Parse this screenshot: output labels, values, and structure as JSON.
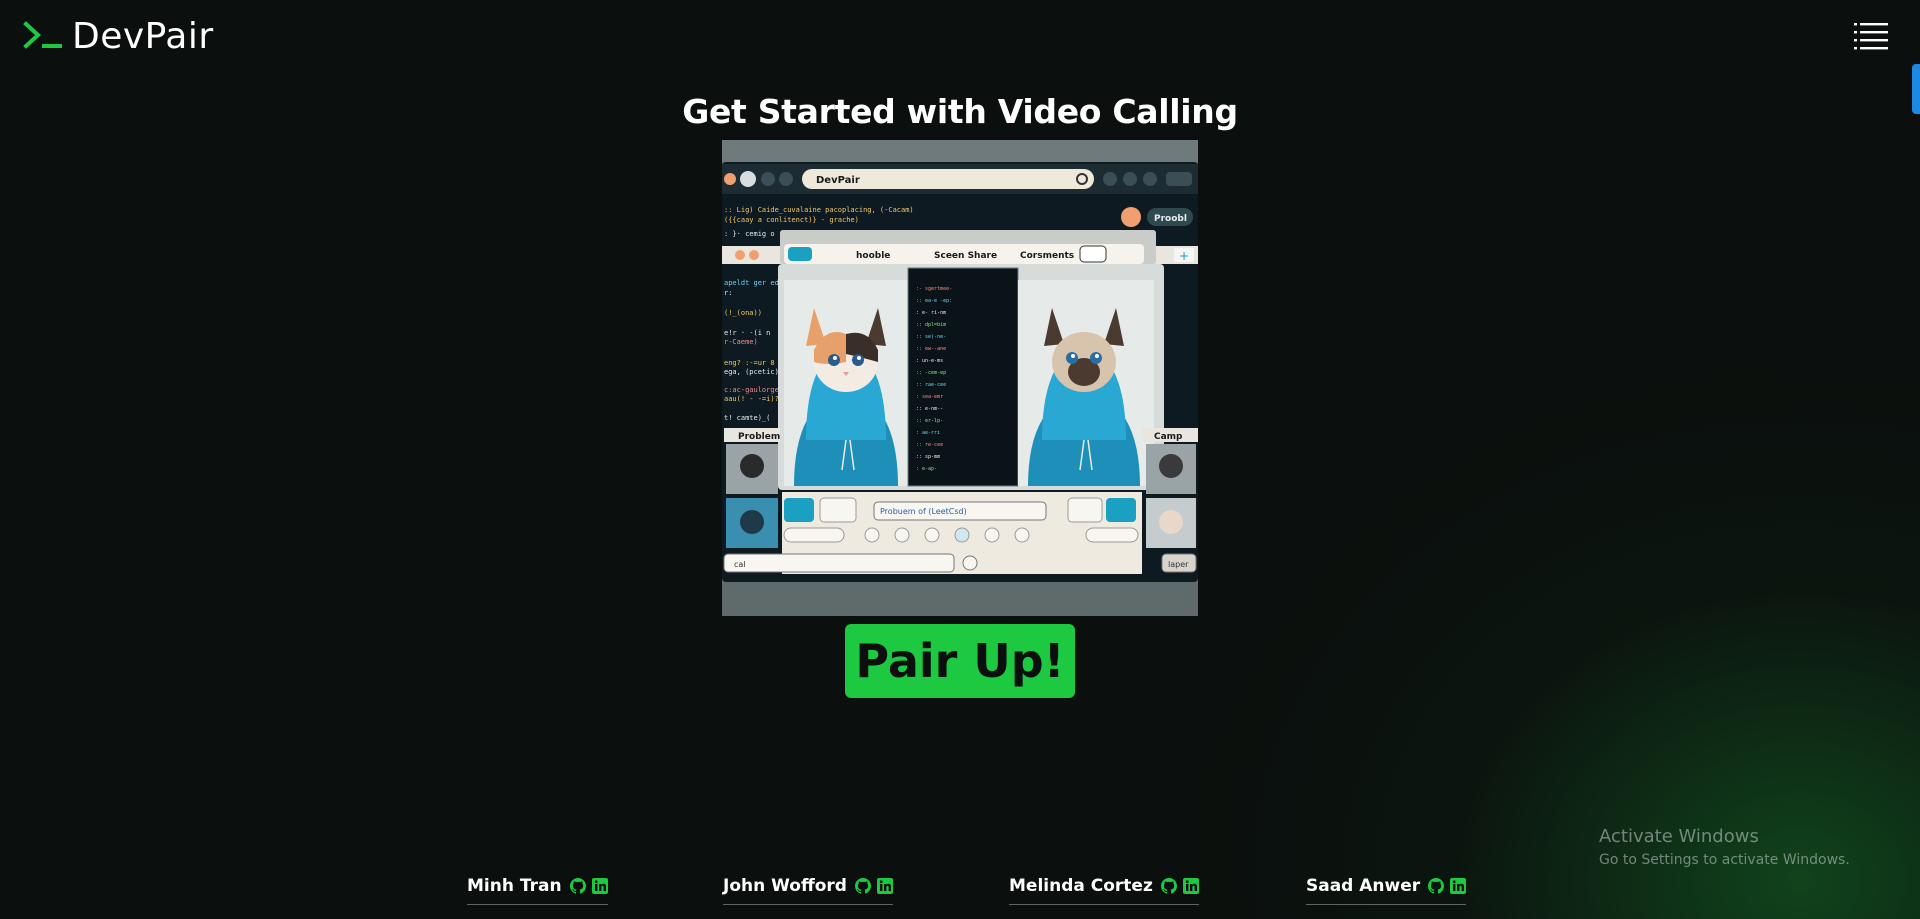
{
  "header": {
    "logo_text": "DevPair",
    "logo_icon": "terminal-prompt-icon",
    "menu_icon": "hamburger-menu-icon"
  },
  "hero": {
    "title": "Get Started with Video Calling",
    "cta_label": "Pair Up!"
  },
  "illustration": {
    "window_title": "DevPair",
    "toolbar_items": [
      "hooble",
      "Sceen Share",
      "Corsments"
    ],
    "left_panel_label": "Problem",
    "right_panel_label": "Camp",
    "right_badge": "Proobl",
    "input_placeholder": "Probuem of (LeetCsd)",
    "corner_button": "laper",
    "bottom_select": "cal"
  },
  "team": [
    {
      "name": "Minh Tran",
      "icons": [
        "github-icon",
        "linkedin-icon"
      ]
    },
    {
      "name": "John Wofford",
      "icons": [
        "github-icon",
        "linkedin-icon"
      ]
    },
    {
      "name": "Melinda Cortez",
      "icons": [
        "github-icon",
        "linkedin-icon"
      ]
    },
    {
      "name": "Saad Anwer",
      "icons": [
        "github-icon",
        "linkedin-icon"
      ]
    }
  ],
  "watermark": {
    "line1": "Activate Windows",
    "line2": "Go to Settings to activate Windows."
  },
  "colors": {
    "background": "#0b0f0d",
    "accent_green": "#1cc940",
    "text": "#ffffff"
  }
}
